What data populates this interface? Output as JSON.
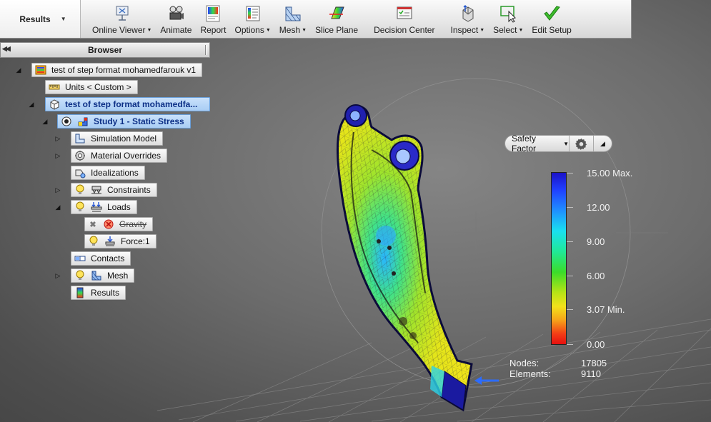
{
  "ribbon": {
    "tab_label": "Results",
    "buttons": [
      {
        "label": "Online Viewer",
        "dropdown": true,
        "icon": "online-viewer-icon"
      },
      {
        "label": "Animate",
        "dropdown": false,
        "icon": "animate-icon"
      },
      {
        "label": "Report",
        "dropdown": false,
        "icon": "report-icon"
      },
      {
        "label": "Options",
        "dropdown": true,
        "icon": "options-icon"
      },
      {
        "label": "Mesh",
        "dropdown": true,
        "icon": "mesh-icon"
      },
      {
        "label": "Slice Plane",
        "dropdown": false,
        "icon": "slice-plane-icon"
      },
      {
        "label": "Decision Center",
        "dropdown": false,
        "icon": "decision-center-icon"
      },
      {
        "label": "Inspect",
        "dropdown": true,
        "icon": "inspect-icon"
      },
      {
        "label": "Select",
        "dropdown": true,
        "icon": "select-icon"
      },
      {
        "label": "Edit Setup",
        "dropdown": false,
        "icon": "edit-setup-checkmark-icon"
      }
    ]
  },
  "browser": {
    "title": "Browser",
    "root": "test of step format mohamedfarouk v1",
    "units": "Units < Custom >",
    "design": "test of step format mohamedfa...",
    "study": "Study 1 - Static Stress",
    "items": {
      "simulation_model": "Simulation Model",
      "material_overrides": "Material Overrides",
      "idealizations": "Idealizations",
      "constraints": "Constraints",
      "loads": "Loads",
      "gravity": "Gravity",
      "force": "Force:1",
      "contacts": "Contacts",
      "mesh": "Mesh",
      "results": "Results"
    }
  },
  "result_control": {
    "selected": "Safety Factor",
    "icons": [
      "gear-icon",
      "collapse-arrow-icon"
    ]
  },
  "legend": {
    "max_label": "15.00 Max.",
    "labels": [
      "12.00",
      "9.00",
      "6.00"
    ],
    "min_label": "3.07 Min.",
    "zero_label": "0.00"
  },
  "stats": {
    "nodes_label": "Nodes:",
    "nodes_value": "17805",
    "elements_label": "Elements:",
    "elements_value": "9110"
  },
  "colors": {
    "legend_top": "#1b12c8",
    "legend_bottom": "#e61010",
    "selection": "#a9cdf4",
    "viewport_bg": "#6c6c6c"
  }
}
